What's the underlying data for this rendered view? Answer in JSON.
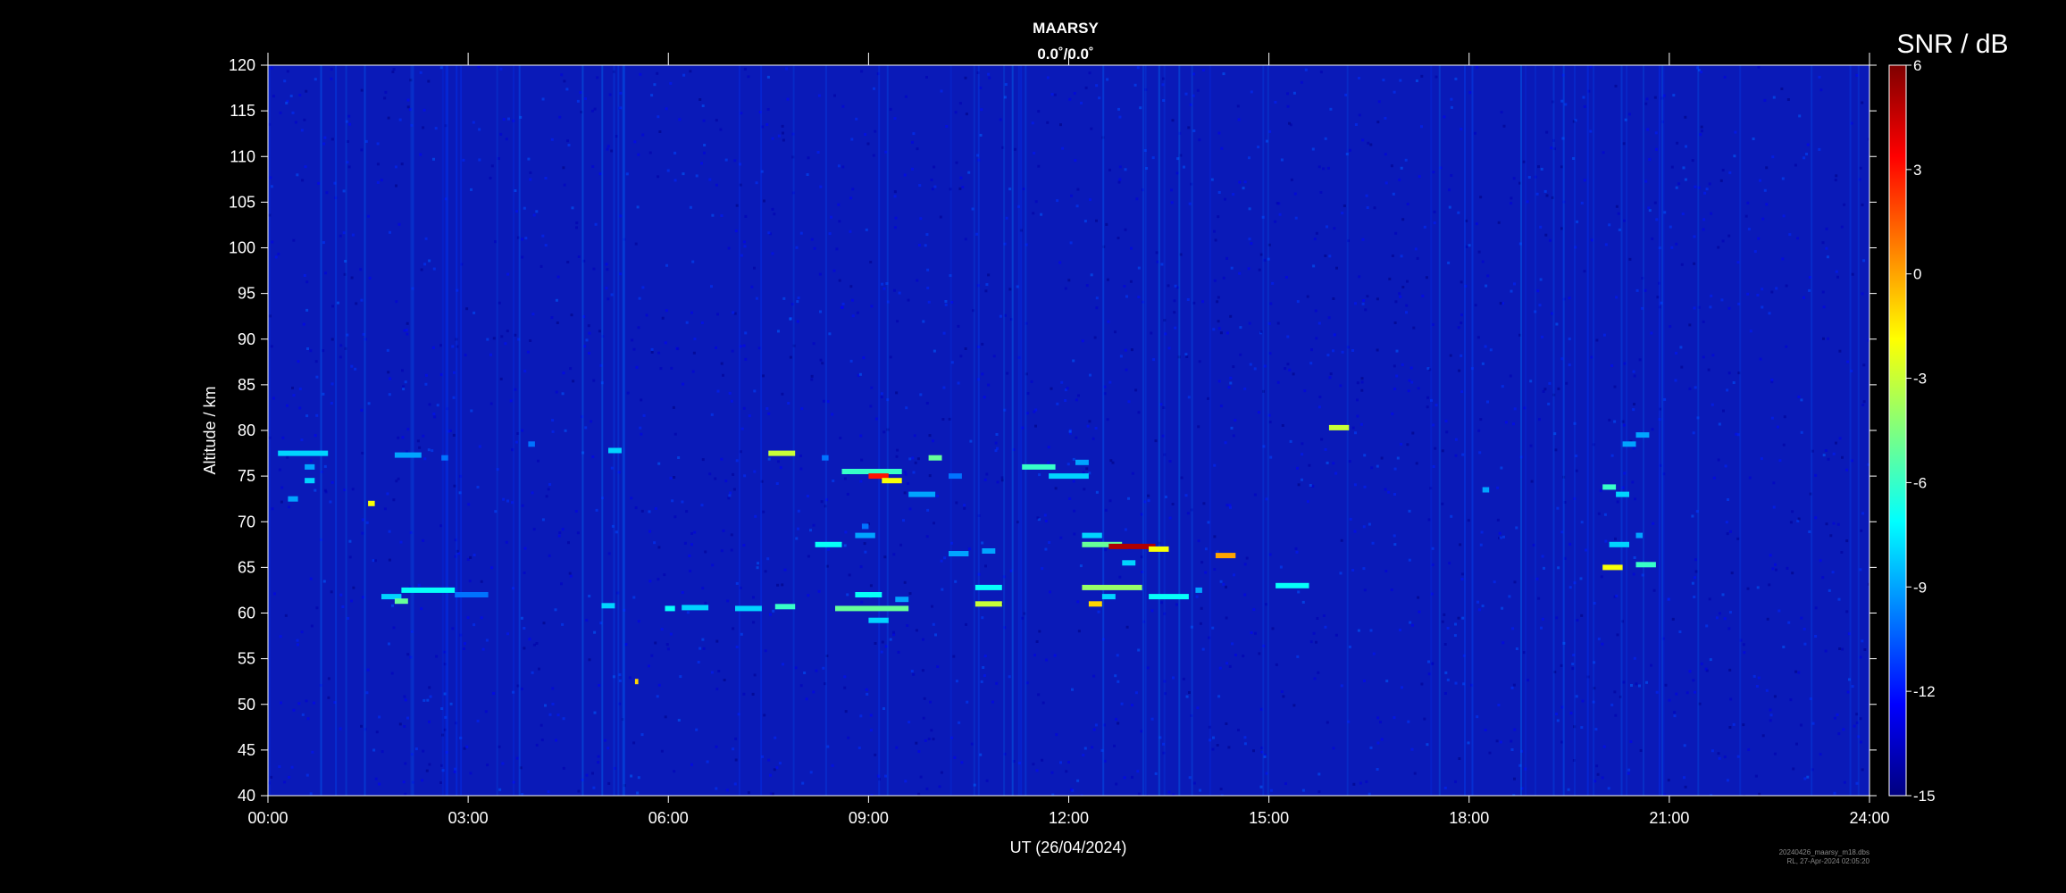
{
  "chart_data": {
    "type": "heatmap",
    "title": "MAARSY",
    "subtitle": "0.0˚/0.0˚",
    "xlabel": "UT (26/04/2024)",
    "ylabel": "Altitude / km",
    "x_ticks": [
      "00:00",
      "03:00",
      "06:00",
      "09:00",
      "12:00",
      "15:00",
      "18:00",
      "21:00",
      "24:00"
    ],
    "xlim": [
      0,
      24
    ],
    "ylim": [
      40,
      120
    ],
    "y_ticks": [
      40,
      45,
      50,
      55,
      60,
      65,
      70,
      75,
      80,
      85,
      90,
      95,
      100,
      105,
      110,
      115,
      120
    ],
    "colorbar": {
      "label": "SNR / dB",
      "range": [
        -15,
        6
      ],
      "ticks": [
        6,
        3,
        0,
        -3,
        -6,
        -9,
        -12,
        -15
      ],
      "colormap": "jet"
    },
    "background_snr_db": -13.5,
    "echo_features": [
      {
        "t_start": 0.15,
        "t_end": 0.9,
        "alt": 77.5,
        "snr": -8
      },
      {
        "t_start": 0.55,
        "t_end": 0.7,
        "alt": 76,
        "snr": -9
      },
      {
        "t_start": 0.55,
        "t_end": 0.7,
        "alt": 74.5,
        "snr": -8
      },
      {
        "t_start": 0.3,
        "t_end": 0.45,
        "alt": 72.5,
        "snr": -9
      },
      {
        "t_start": 1.5,
        "t_end": 1.6,
        "alt": 72,
        "snr": -2
      },
      {
        "t_start": 1.9,
        "t_end": 2.3,
        "alt": 77.3,
        "snr": -9
      },
      {
        "t_start": 2.6,
        "t_end": 2.7,
        "alt": 77,
        "snr": -10
      },
      {
        "t_start": 1.7,
        "t_end": 2.0,
        "alt": 61.8,
        "snr": -8
      },
      {
        "t_start": 1.9,
        "t_end": 2.1,
        "alt": 61.3,
        "snr": -5
      },
      {
        "t_start": 2.0,
        "t_end": 2.8,
        "alt": 62.5,
        "snr": -7
      },
      {
        "t_start": 2.8,
        "t_end": 3.3,
        "alt": 62,
        "snr": -10
      },
      {
        "t_start": 3.9,
        "t_end": 4.0,
        "alt": 78.5,
        "snr": -10
      },
      {
        "t_start": 5.1,
        "t_end": 5.3,
        "alt": 77.8,
        "snr": -8
      },
      {
        "t_start": 5.0,
        "t_end": 5.2,
        "alt": 60.8,
        "snr": -8
      },
      {
        "t_start": 5.95,
        "t_end": 6.1,
        "alt": 60.5,
        "snr": -7
      },
      {
        "t_start": 6.2,
        "t_end": 6.6,
        "alt": 60.6,
        "snr": -8
      },
      {
        "t_start": 7.0,
        "t_end": 7.4,
        "alt": 60.5,
        "snr": -8
      },
      {
        "t_start": 7.6,
        "t_end": 7.9,
        "alt": 60.7,
        "snr": -6
      },
      {
        "t_start": 5.5,
        "t_end": 5.55,
        "alt": 52.5,
        "snr": -1
      },
      {
        "t_start": 7.5,
        "t_end": 7.9,
        "alt": 77.5,
        "snr": -3
      },
      {
        "t_start": 8.3,
        "t_end": 8.4,
        "alt": 77,
        "snr": -10
      },
      {
        "t_start": 8.6,
        "t_end": 9.5,
        "alt": 75.5,
        "snr": -6
      },
      {
        "t_start": 9.0,
        "t_end": 9.3,
        "alt": 75,
        "snr": 3
      },
      {
        "t_start": 9.2,
        "t_end": 9.5,
        "alt": 74.5,
        "snr": -2
      },
      {
        "t_start": 9.6,
        "t_end": 10.0,
        "alt": 73,
        "snr": -9
      },
      {
        "t_start": 9.9,
        "t_end": 10.1,
        "alt": 77,
        "snr": -5
      },
      {
        "t_start": 10.2,
        "t_end": 10.4,
        "alt": 75,
        "snr": -10
      },
      {
        "t_start": 8.2,
        "t_end": 8.6,
        "alt": 67.5,
        "snr": -7
      },
      {
        "t_start": 8.8,
        "t_end": 9.1,
        "alt": 68.5,
        "snr": -9
      },
      {
        "t_start": 8.9,
        "t_end": 9.0,
        "alt": 69.5,
        "snr": -10
      },
      {
        "t_start": 8.5,
        "t_end": 9.6,
        "alt": 60.5,
        "snr": -5
      },
      {
        "t_start": 8.8,
        "t_end": 9.2,
        "alt": 62,
        "snr": -7
      },
      {
        "t_start": 9.0,
        "t_end": 9.3,
        "alt": 59.2,
        "snr": -8
      },
      {
        "t_start": 9.4,
        "t_end": 9.6,
        "alt": 61.5,
        "snr": -9
      },
      {
        "t_start": 10.6,
        "t_end": 11.0,
        "alt": 62.8,
        "snr": -7
      },
      {
        "t_start": 10.6,
        "t_end": 11.0,
        "alt": 61,
        "snr": -3
      },
      {
        "t_start": 10.2,
        "t_end": 10.5,
        "alt": 66.5,
        "snr": -9
      },
      {
        "t_start": 10.7,
        "t_end": 10.9,
        "alt": 66.8,
        "snr": -9
      },
      {
        "t_start": 11.3,
        "t_end": 11.8,
        "alt": 76,
        "snr": -6
      },
      {
        "t_start": 11.7,
        "t_end": 12.3,
        "alt": 75,
        "snr": -8
      },
      {
        "t_start": 12.1,
        "t_end": 12.3,
        "alt": 76.5,
        "snr": -9
      },
      {
        "t_start": 12.2,
        "t_end": 12.5,
        "alt": 68.5,
        "snr": -8
      },
      {
        "t_start": 12.2,
        "t_end": 12.8,
        "alt": 67.5,
        "snr": -5
      },
      {
        "t_start": 12.6,
        "t_end": 13.3,
        "alt": 67.3,
        "snr": 5
      },
      {
        "t_start": 13.2,
        "t_end": 13.5,
        "alt": 67,
        "snr": -2
      },
      {
        "t_start": 12.8,
        "t_end": 13.0,
        "alt": 65.5,
        "snr": -8
      },
      {
        "t_start": 12.2,
        "t_end": 13.1,
        "alt": 62.8,
        "snr": -4
      },
      {
        "t_start": 12.3,
        "t_end": 12.5,
        "alt": 61,
        "snr": -1
      },
      {
        "t_start": 12.5,
        "t_end": 12.7,
        "alt": 61.8,
        "snr": -8
      },
      {
        "t_start": 13.2,
        "t_end": 13.8,
        "alt": 61.8,
        "snr": -7
      },
      {
        "t_start": 13.9,
        "t_end": 14.0,
        "alt": 62.5,
        "snr": -9
      },
      {
        "t_start": 14.2,
        "t_end": 14.5,
        "alt": 66.3,
        "snr": 0
      },
      {
        "t_start": 15.1,
        "t_end": 15.6,
        "alt": 63,
        "snr": -7
      },
      {
        "t_start": 15.9,
        "t_end": 16.2,
        "alt": 80.3,
        "snr": -3
      },
      {
        "t_start": 18.2,
        "t_end": 18.3,
        "alt": 73.5,
        "snr": -9
      },
      {
        "t_start": 20.0,
        "t_end": 20.2,
        "alt": 73.8,
        "snr": -6
      },
      {
        "t_start": 20.2,
        "t_end": 20.4,
        "alt": 73,
        "snr": -8
      },
      {
        "t_start": 20.3,
        "t_end": 20.5,
        "alt": 78.5,
        "snr": -9
      },
      {
        "t_start": 20.5,
        "t_end": 20.7,
        "alt": 79.5,
        "snr": -9
      },
      {
        "t_start": 20.1,
        "t_end": 20.4,
        "alt": 67.5,
        "snr": -8
      },
      {
        "t_start": 20.0,
        "t_end": 20.3,
        "alt": 65,
        "snr": -2
      },
      {
        "t_start": 20.5,
        "t_end": 20.8,
        "alt": 65.3,
        "snr": -6
      },
      {
        "t_start": 20.5,
        "t_end": 20.6,
        "alt": 68.5,
        "snr": -9
      }
    ]
  },
  "footnote": {
    "line1": "20240426_maarsy_m18.dbs",
    "line2": "RL, 27-Apr-2024 02:05:20"
  },
  "colors": {
    "background": "#000000",
    "axis": "#ffffff",
    "field_base": "#0a1ab8"
  }
}
